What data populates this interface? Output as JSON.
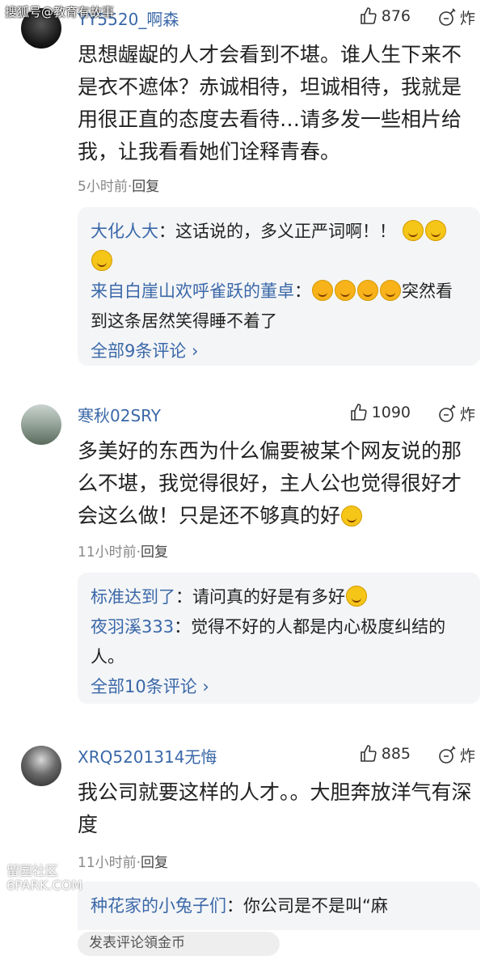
{
  "watermark": {
    "top": "搜狐号@教育有故事",
    "bottom_line1": "留园社区",
    "bottom_line2": "6PARK.COM"
  },
  "comments": [
    {
      "username": "YY5520_啊森",
      "likes": "876",
      "react_label": "炸",
      "text": "思想龌龊的人才会看到不堪。谁人生下来不是衣不遮体？赤诚相待，坦诚相待，我就是用很正直的态度去看待…请多发一些相片给我，让我看看她们诠释青春。",
      "time": "5小时前",
      "reply_label": "回复",
      "replies": [
        {
          "name": "大化人大",
          "sep": "：",
          "text": "这话说的，多义正严词啊！！"
        },
        {
          "name": "来自白崖山欢呼雀跃的董卓",
          "sep": "：",
          "text": "突然看到这条居然笑得睡不着了"
        }
      ],
      "all_link": "全部9条评论 ›"
    },
    {
      "username": "寒秋02SRY",
      "likes": "1090",
      "react_label": "炸",
      "text": "多美好的东西为什么偏要被某个网友说的那么不堪，我觉得很好，主人公也觉得很好才会这么做！只是还不够真的好",
      "time": "11小时前",
      "reply_label": "回复",
      "replies": [
        {
          "name": "标准达到了",
          "sep": "：",
          "text": "请问真的好是有多好"
        },
        {
          "name": "夜羽溪333",
          "sep": "：",
          "text": "觉得不好的人都是内心极度纠结的人。"
        }
      ],
      "all_link": "全部10条评论 ›"
    },
    {
      "username": "XRQ5201314无悔",
      "likes": "885",
      "react_label": "炸",
      "text": "我公司就要这样的人才。。大胆奔放洋气有深度",
      "time": "11小时前",
      "reply_label": "回复",
      "replies": [
        {
          "name": "种花家的小兔子们",
          "sep": "：",
          "text": "你公司是不是叫“麻"
        }
      ]
    }
  ],
  "bottom": {
    "input_placeholder": "发表评论領金币"
  },
  "colors": {
    "username": "#3a68a8",
    "reply_bg": "#f4f5f7",
    "emoji": "#f5c518"
  }
}
